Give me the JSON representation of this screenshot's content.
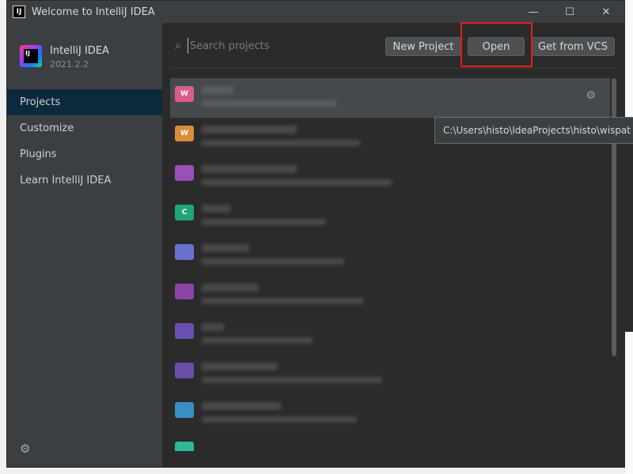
{
  "window": {
    "title": "Welcome to IntelliJ IDEA"
  },
  "titlebar_controls": {
    "minimize": "—",
    "maximize": "☐",
    "close": "✕"
  },
  "sidebar": {
    "product": {
      "logo_text": "IJ",
      "name": "IntelliJ IDEA",
      "version": "2021.2.2"
    },
    "items": [
      {
        "label": "Projects",
        "active": true
      },
      {
        "label": "Customize",
        "active": false
      },
      {
        "label": "Plugins",
        "active": false
      },
      {
        "label": "Learn IntelliJ IDEA",
        "active": false
      }
    ],
    "settings_icon": "gear-icon"
  },
  "main": {
    "search": {
      "placeholder": "Search projects",
      "value": ""
    },
    "buttons": {
      "new_project": "New Project",
      "open": "Open",
      "get_from_vcs": "Get from VCS"
    },
    "projects": [
      {
        "icon_text": "W",
        "icon_color": "#d95c8a",
        "selected": true
      },
      {
        "icon_text": "W",
        "icon_color": "#d98c3a",
        "selected": false
      },
      {
        "icon_text": "",
        "icon_color": "#9b4fb8",
        "selected": false
      },
      {
        "icon_text": "C",
        "icon_color": "#1fa67a",
        "selected": false
      },
      {
        "icon_text": "",
        "icon_color": "#6a72d0",
        "selected": false
      },
      {
        "icon_text": "",
        "icon_color": "#8a44a8",
        "selected": false
      },
      {
        "icon_text": "",
        "icon_color": "#6a4fb0",
        "selected": false
      },
      {
        "icon_text": "",
        "icon_color": "#6a4fa8",
        "selected": false
      },
      {
        "icon_text": "",
        "icon_color": "#3a8fc4",
        "selected": false
      },
      {
        "icon_text": "",
        "icon_color": "#2fb89a",
        "selected": false
      }
    ],
    "tooltip": "C:\\Users\\histo\\IdeaProjects\\histo\\wispat"
  },
  "colors": {
    "highlight": "#e0201c",
    "active_nav": "#0d293e"
  }
}
